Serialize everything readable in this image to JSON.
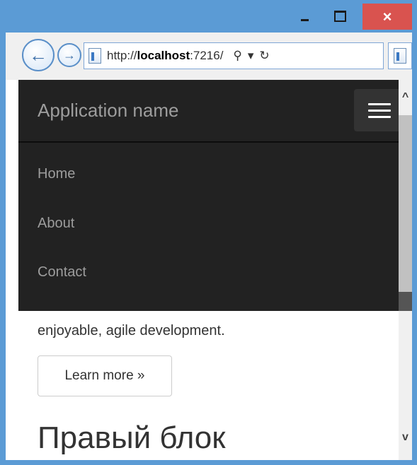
{
  "window": {
    "close_glyph": "×"
  },
  "browser": {
    "url_prefix": "http://",
    "url_host": "localhost",
    "url_suffix": ":7216/",
    "back_glyph": "←",
    "forward_glyph": "→",
    "search_glyph": "⚲",
    "dropdown_glyph": "▾",
    "refresh_glyph": "↻"
  },
  "navbar": {
    "brand": "Application name",
    "items": [
      {
        "label": "Home"
      },
      {
        "label": "About"
      },
      {
        "label": "Contact"
      }
    ]
  },
  "content": {
    "paragraph_tail": "enjoyable, agile development.",
    "learn_more_label": "Learn more »",
    "heading": "Правый блок"
  },
  "scrollbar": {
    "up_glyph": "^",
    "down_glyph": "v"
  },
  "colors": {
    "navbar_bg": "#222222",
    "navbar_text": "#9d9d9d",
    "window_accent": "#5b9bd5",
    "close_button": "#d9534f"
  }
}
